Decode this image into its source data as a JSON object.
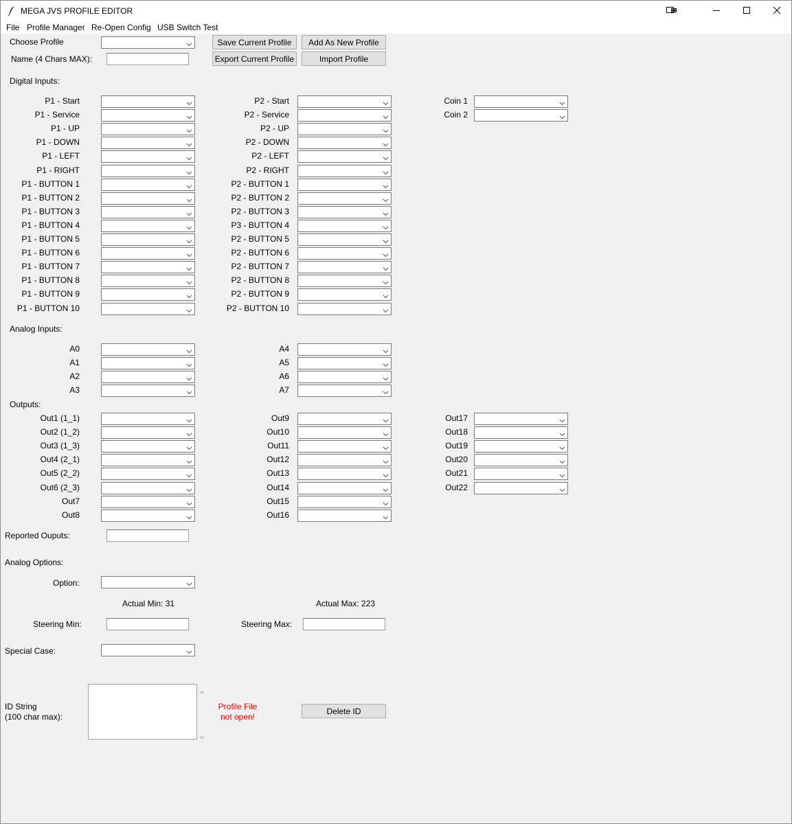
{
  "window": {
    "title": "MEGA JVS PROFILE EDITOR"
  },
  "menu": [
    "File",
    "Profile Manager",
    "Re-Open Config",
    "USB Switch Test"
  ],
  "profile": {
    "choose_label": "Choose Profile",
    "choose_value": "",
    "name_label": "Name (4 Chars MAX):",
    "name_value": "",
    "save_button": "Save Current Profile",
    "add_button": "Add As New Profile",
    "export_button": "Export Current Profile",
    "import_button": "Import Profile"
  },
  "digital": {
    "heading": "Digital Inputs:",
    "col1": [
      "P1 - Start",
      "P1 - Service",
      "P1 - UP",
      "P1 - DOWN",
      "P1 - LEFT",
      "P1 - RIGHT",
      "P1 - BUTTON 1",
      "P1 - BUTTON 2",
      "P1 - BUTTON 3",
      "P1 - BUTTON 4",
      "P1 - BUTTON 5",
      "P1 - BUTTON 6",
      "P1 - BUTTON 7",
      "P1 - BUTTON 8",
      "P1 - BUTTON 9",
      "P1 - BUTTON 10"
    ],
    "col2": [
      "P2 - Start",
      "P2 - Service",
      "P2 - UP",
      "P2 - DOWN",
      "P2 - LEFT",
      "P2 - RIGHT",
      "P2 - BUTTON 1",
      "P2 - BUTTON 2",
      "P2 - BUTTON 3",
      "P3 - BUTTON 4",
      "P2 - BUTTON 5",
      "P2 - BUTTON 6",
      "P2 - BUTTON 7",
      "P2 - BUTTON 8",
      "P2 - BUTTON 9",
      "P2 - BUTTON 10"
    ],
    "col3": [
      "Coin 1",
      "Coin 2"
    ]
  },
  "analog": {
    "heading": "Analog Inputs:",
    "col1": [
      "A0",
      "A1",
      "A2",
      "A3"
    ],
    "col2": [
      "A4",
      "A5",
      "A6",
      "A7"
    ]
  },
  "outputs": {
    "heading": "Outputs:",
    "col1": [
      "Out1 (1_1)",
      "Out2 (1_2)",
      "Out3 (1_3)",
      "Out4 (2_1)",
      "Out5 (2_2)",
      "Out6 (2_3)",
      "Out7",
      "Out8"
    ],
    "col2": [
      "Out9",
      "Out10",
      "Out11",
      "Out12",
      "Out13",
      "Out14",
      "Out15",
      "Out16"
    ],
    "col3": [
      "Out17",
      "Out18",
      "Out19",
      "Out20",
      "Out21",
      "Out22"
    ],
    "reported_label": "Reported Ouputs:",
    "reported_value": ""
  },
  "analog_options": {
    "heading": "Analog Options:",
    "option_label": "Option:",
    "option_value": "",
    "actual_min": "Actual Min: 31",
    "actual_max": "Actual Max: 223",
    "steering_min_label": "Steering Min:",
    "steering_min_value": "",
    "steering_max_label": "Steering Max:",
    "steering_max_value": "",
    "special_case_label": "Special Case:",
    "special_case_value": ""
  },
  "id_string": {
    "label_line1": "ID String",
    "label_line2": "(100 char max):",
    "value": "",
    "status_line1": "Profile File",
    "status_line2": "not open!",
    "delete_button": "Delete ID"
  },
  "colors": {
    "status_error": "#ff0000",
    "background": "#f0f0f0"
  }
}
